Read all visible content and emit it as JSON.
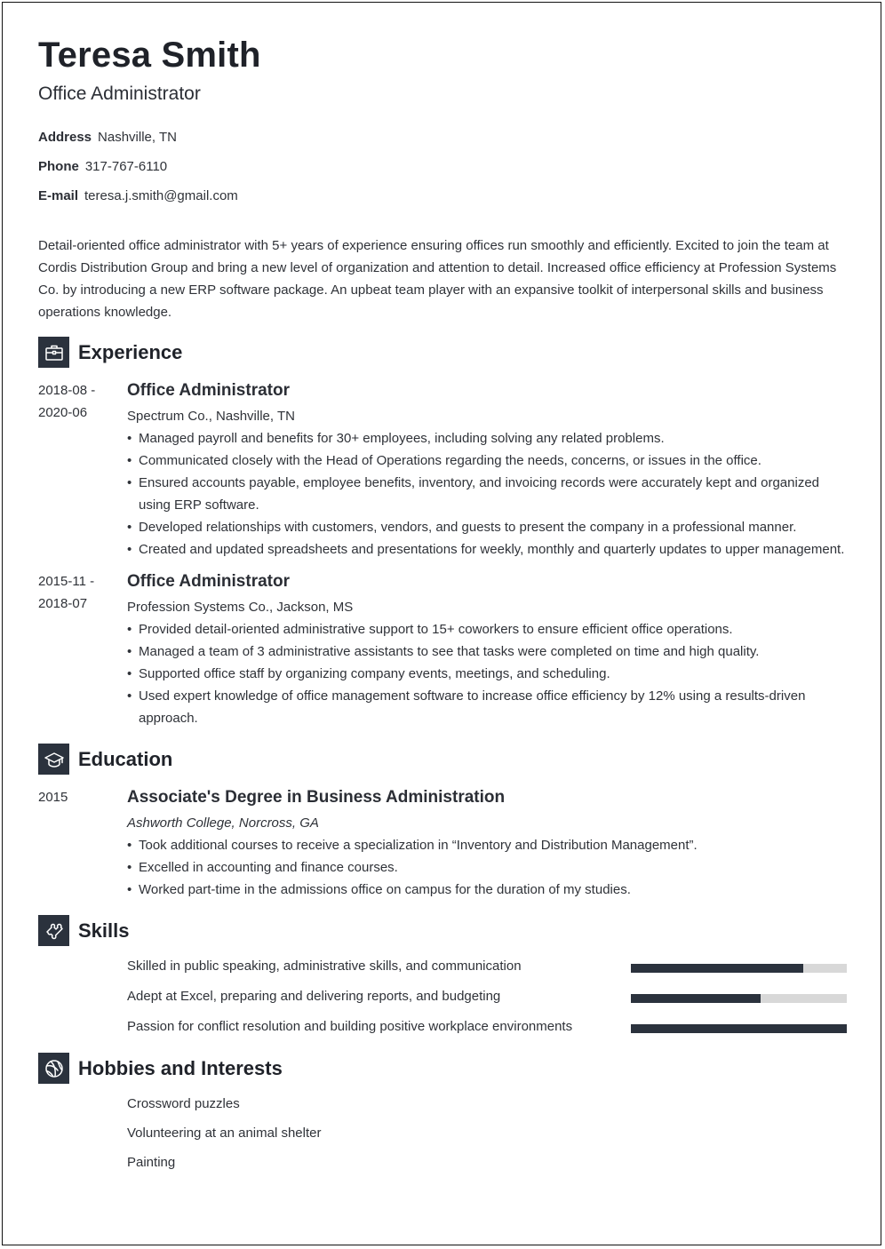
{
  "header": {
    "name": "Teresa Smith",
    "role": "Office Administrator"
  },
  "contact": [
    {
      "label": "Address",
      "value": "Nashville, TN"
    },
    {
      "label": "Phone",
      "value": "317-767-6110"
    },
    {
      "label": "E-mail",
      "value": "teresa.j.smith@gmail.com"
    }
  ],
  "summary": "Detail-oriented office administrator with 5+ years of experience ensuring offices run smoothly and efficiently. Excited to join the team at Cordis Distribution Group and bring a new level of organization and attention to detail. Increased office efficiency at Profession Systems Co. by introducing a new ERP software package. An upbeat team player with an expansive toolkit of interpersonal skills and business operations knowledge.",
  "sections": {
    "experience": {
      "title": "Experience",
      "icon": "briefcase-icon"
    },
    "education": {
      "title": "Education",
      "icon": "graduation-cap-icon"
    },
    "skills": {
      "title": "Skills",
      "icon": "puzzle-icon"
    },
    "hobbies": {
      "title": "Hobbies and Interests",
      "icon": "basketball-icon"
    }
  },
  "experience": [
    {
      "date_start": "2018-08 -",
      "date_end": "2020-06",
      "title": "Office Administrator",
      "company": "Spectrum Co., Nashville, TN",
      "bullets": [
        "Managed payroll and benefits for 30+ employees, including solving any related problems.",
        "Communicated closely with the Head of Operations regarding the needs, concerns, or issues in the office.",
        "Ensured accounts payable, employee benefits, inventory, and invoicing records were accurately kept and organized using ERP software.",
        "Developed relationships with customers, vendors, and guests to present the company in a professional manner.",
        "Created and updated spreadsheets and presentations for weekly, monthly and quarterly updates to upper management."
      ]
    },
    {
      "date_start": "2015-11 -",
      "date_end": "2018-07",
      "title": "Office Administrator",
      "company": "Profession Systems Co., Jackson, MS",
      "bullets": [
        "Provided detail-oriented administrative support to 15+ coworkers to ensure efficient office operations.",
        "Managed a team of 3 administrative assistants to see that tasks were completed on time and high quality.",
        "Supported office staff by organizing company events, meetings, and scheduling.",
        "Used expert knowledge of office management software to increase office efficiency by 12% using a results-driven approach."
      ]
    }
  ],
  "education": [
    {
      "date": "2015",
      "degree": "Associate's Degree in Business Administration",
      "school": "Ashworth College, Norcross, GA",
      "bullets": [
        "Took additional courses to receive a specialization in “Inventory and Distribution Management”.",
        "Excelled in accounting and finance courses.",
        "Worked part-time in the admissions office on campus for the duration of my studies."
      ]
    }
  ],
  "skills": [
    {
      "label": "Skilled in public speaking, administrative skills, and communication",
      "level": 0.8
    },
    {
      "label": "Adept at Excel, preparing and delivering reports, and budgeting",
      "level": 0.6
    },
    {
      "label": "Passion for conflict resolution and building positive workplace environments",
      "level": 1.0
    }
  ],
  "hobbies": [
    "Crossword puzzles",
    "Volunteering at an animal shelter",
    "Painting"
  ],
  "colors": {
    "accent": "#2b323d",
    "bar_track": "#d8d8d8",
    "text": "#2f3238"
  }
}
